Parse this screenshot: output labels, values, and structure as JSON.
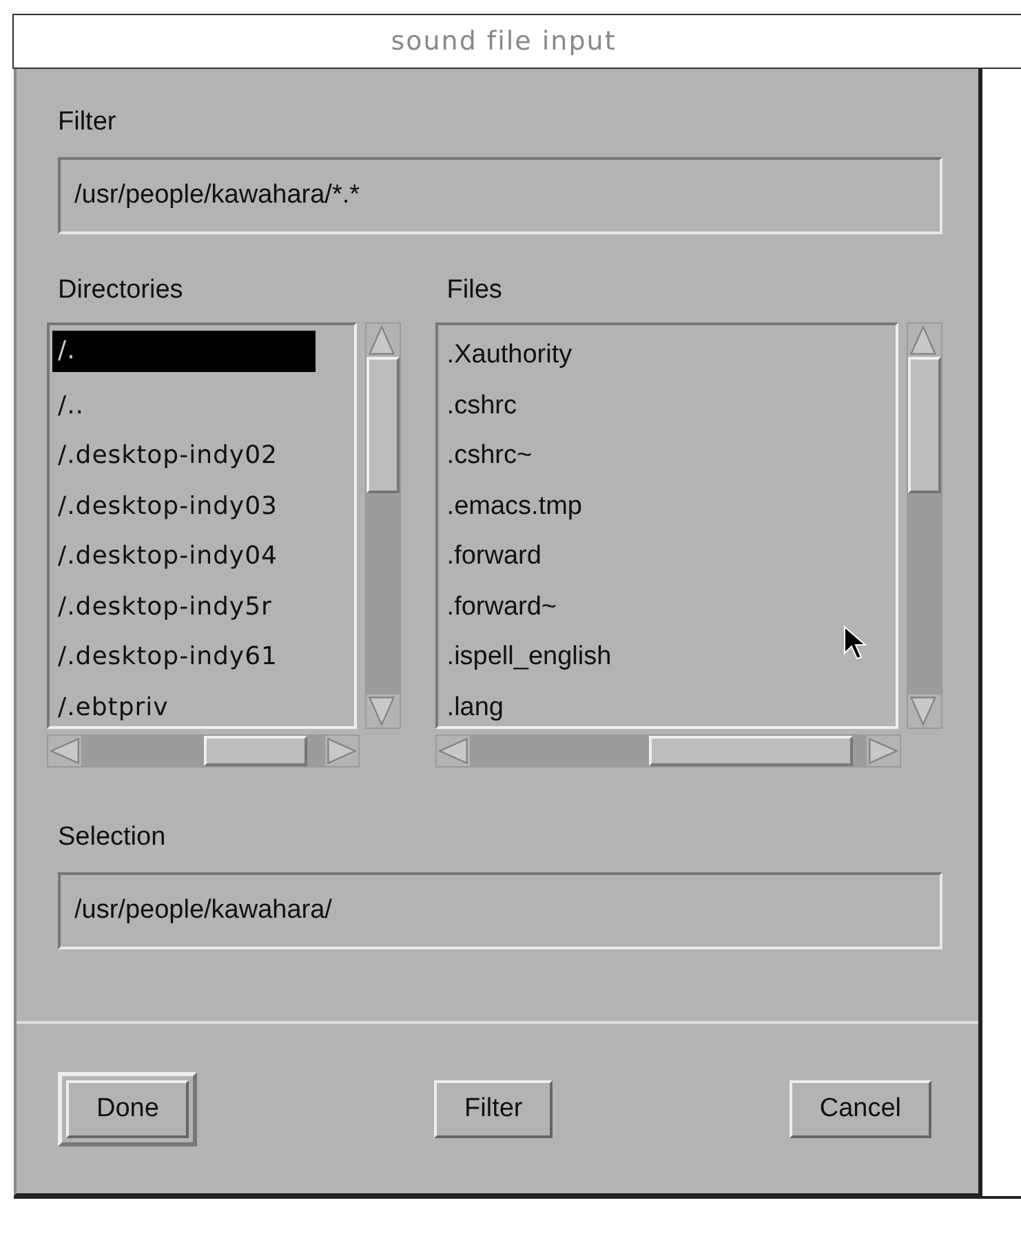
{
  "window": {
    "title": "sound file input"
  },
  "filter": {
    "label": "Filter",
    "value": "/usr/people/kawahara/*.*"
  },
  "directories": {
    "label": "Directories",
    "items": [
      {
        "name": "/.",
        "selected": true
      },
      {
        "name": "/..",
        "selected": false
      },
      {
        "name": "/.desktop-indy02",
        "selected": false
      },
      {
        "name": "/.desktop-indy03",
        "selected": false
      },
      {
        "name": "/.desktop-indy04",
        "selected": false
      },
      {
        "name": "/.desktop-indy5r",
        "selected": false
      },
      {
        "name": "/.desktop-indy61",
        "selected": false
      },
      {
        "name": "/.ebtpriv",
        "selected": false
      }
    ]
  },
  "files": {
    "label": "Files",
    "items": [
      {
        "name": ".Xauthority",
        "selected": false
      },
      {
        "name": ".cshrc",
        "selected": false
      },
      {
        "name": ".cshrc~",
        "selected": false
      },
      {
        "name": ".emacs.tmp",
        "selected": false
      },
      {
        "name": ".forward",
        "selected": false
      },
      {
        "name": ".forward~",
        "selected": false
      },
      {
        "name": ".ispell_english",
        "selected": false
      },
      {
        "name": ".lang",
        "selected": false
      }
    ]
  },
  "selection": {
    "label": "Selection",
    "value": "/usr/people/kawahara/"
  },
  "buttons": [
    {
      "label": "Done",
      "default": true
    },
    {
      "label": "Filter",
      "default": false
    },
    {
      "label": "Cancel",
      "default": false
    }
  ]
}
